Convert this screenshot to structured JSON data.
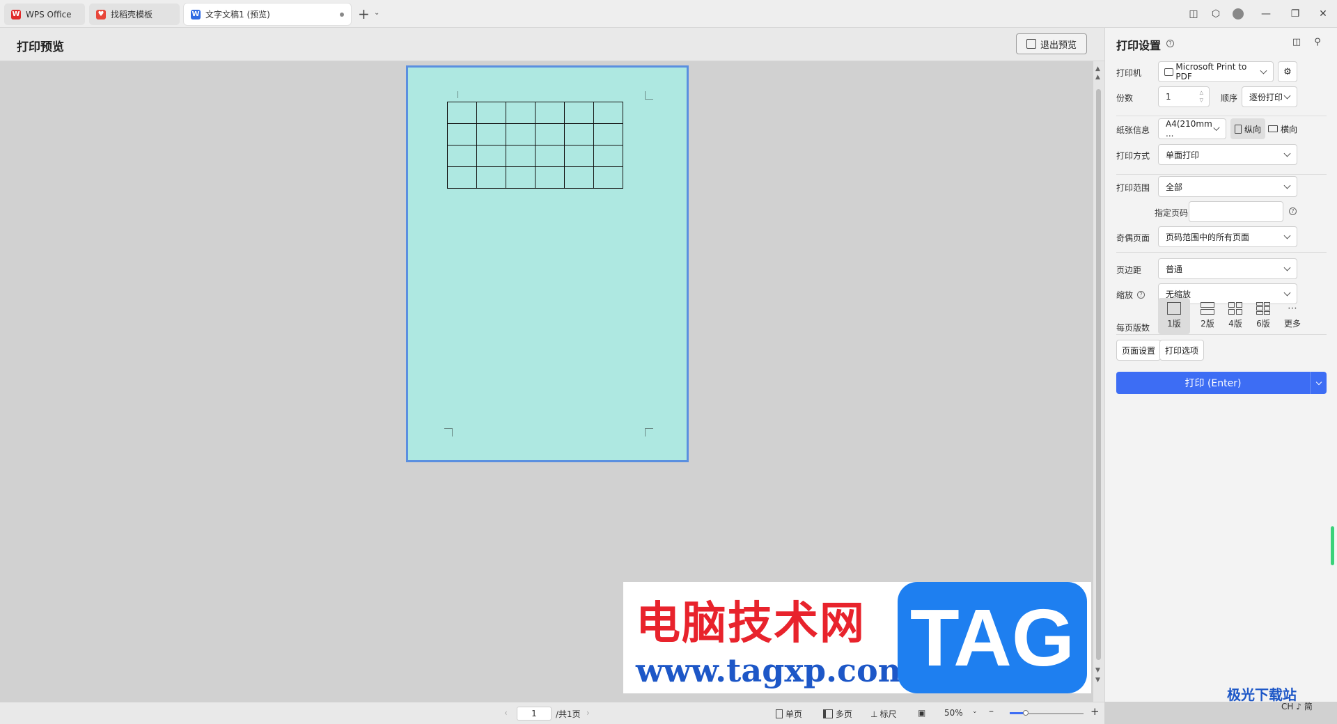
{
  "tabs": [
    {
      "label": "WPS Office",
      "icon": "wps-logo-icon"
    },
    {
      "label": "找稻壳模板",
      "icon": "daoke-icon"
    },
    {
      "label": "文字文稿1 (预览)",
      "icon": "writer-doc-icon"
    }
  ],
  "header": {
    "title": "打印预览",
    "exit_label": "退出预览"
  },
  "panel": {
    "title": "打印设置",
    "printer_label": "打印机",
    "printer_value": "Microsoft Print to PDF",
    "copies_label": "份数",
    "copies_value": "1",
    "order_label": "顺序",
    "order_value": "逐份打印",
    "paper_label": "纸张信息",
    "paper_value": "A4(210mm ...",
    "portrait_label": "纵向",
    "landscape_label": "横向",
    "mode_label": "打印方式",
    "mode_value": "单面打印",
    "range_label": "打印范围",
    "range_value": "全部",
    "pages_label": "指定页码",
    "pages_value": "",
    "oddeven_label": "奇偶页面",
    "oddeven_value": "页码范围中的所有页面",
    "margin_label": "页边距",
    "margin_value": "普通",
    "scale_label": "缩放",
    "scale_value": "无缩放",
    "perpage_label": "每页版数",
    "layouts": [
      "1版",
      "2版",
      "4版",
      "6版",
      "更多"
    ],
    "page_setup_label": "页面设置",
    "print_options_label": "打印选项",
    "print_button_label": "打印 (Enter)"
  },
  "preview": {
    "table_rows": 4,
    "table_cols": 6
  },
  "statusbar": {
    "page_current": "1",
    "page_total": "/共1页",
    "single_label": "单页",
    "multi_label": "多页",
    "ruler_label": "标尺",
    "zoom_value": "50%",
    "zoom_fraction": 0.22
  },
  "watermark": {
    "cn_text": "电脑技术网",
    "url_text": "www.tagxp.com",
    "tag_text": "TAG",
    "corner_text": "极光下载站",
    "ime_text": "CH ♪ 简"
  },
  "colors": {
    "accent": "#3d6df4",
    "page_bg": "#aee8e1",
    "page_border": "#5a8fe0"
  }
}
